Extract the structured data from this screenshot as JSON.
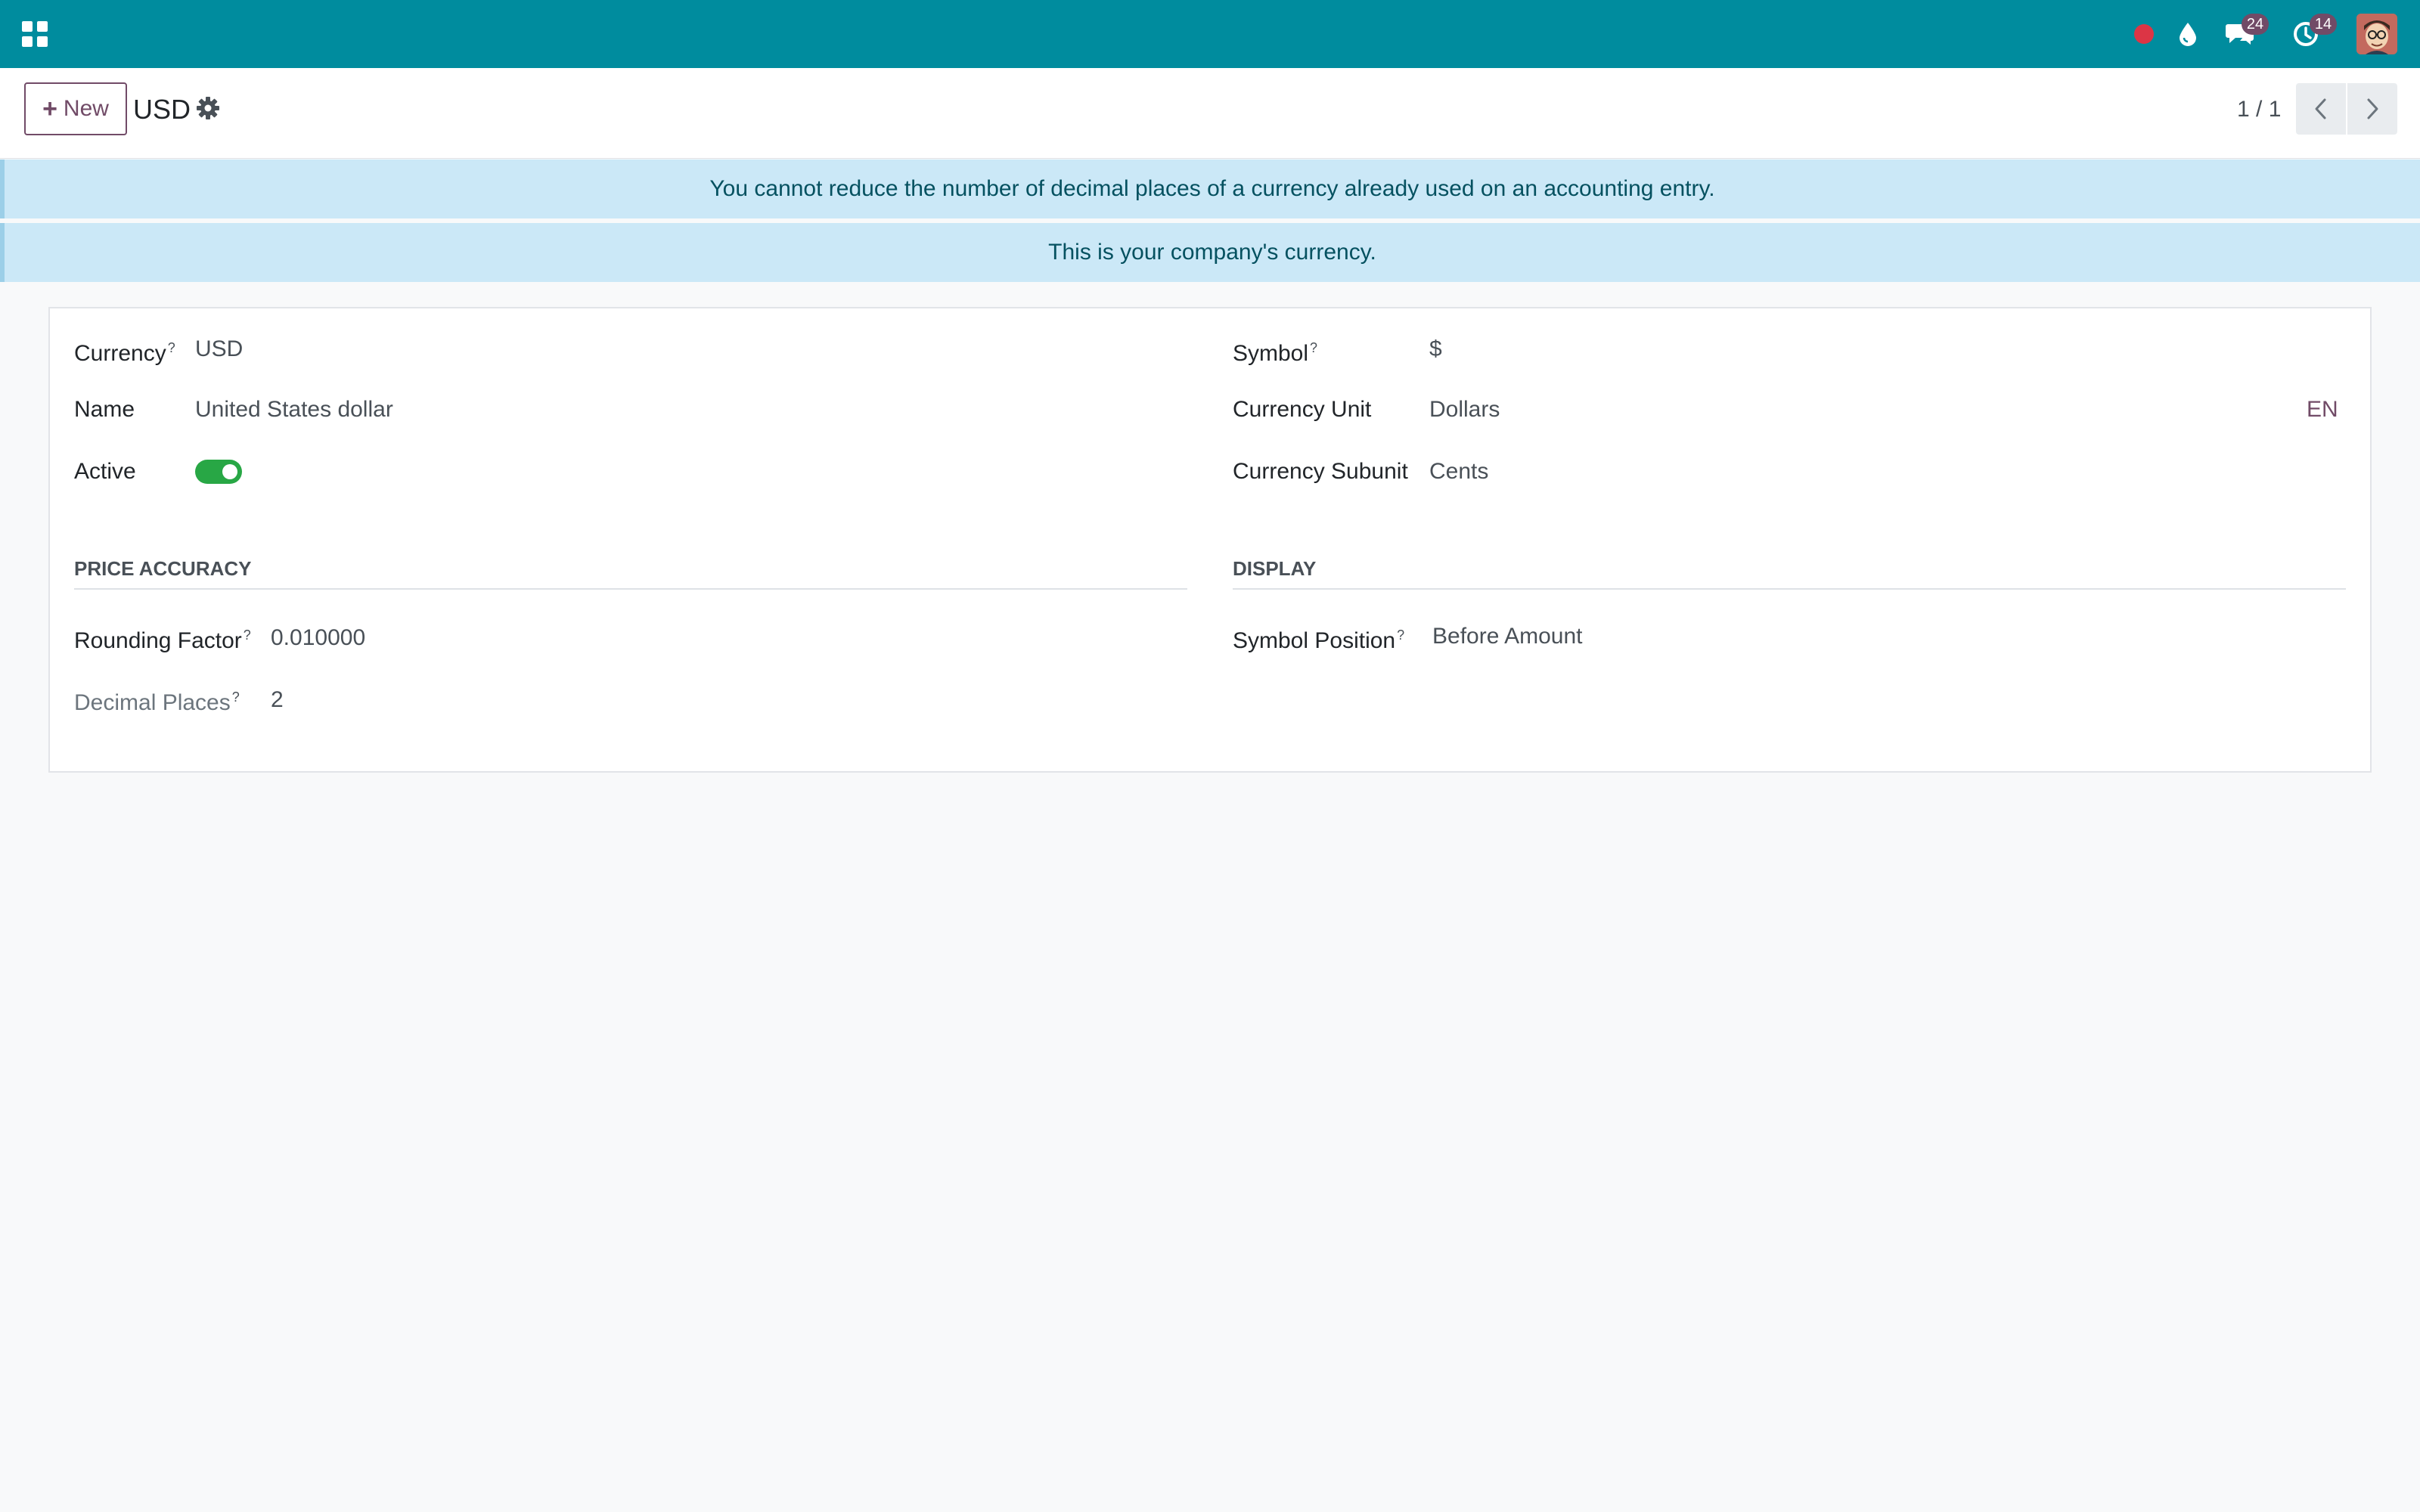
{
  "navbar": {
    "apps_icon": "apps-grid-icon",
    "record_icon": "record-dot-icon",
    "drop_icon": "droplet-icon",
    "chat_icon": "chat-bubbles-icon",
    "chat_count": "24",
    "activity_icon": "clock-icon",
    "activity_count": "14",
    "avatar_icon": "user-avatar-icon",
    "color": "#008c9e"
  },
  "control_panel": {
    "new_label": "New",
    "record_title": "USD",
    "gear_icon": "gear-icon",
    "pager_value": "1 / 1",
    "prev_icon": "chevron-left-icon",
    "next_icon": "chevron-right-icon"
  },
  "alerts": [
    "You cannot reduce the number of decimal places of a currency already used on an accounting entry.",
    "This is your company's currency."
  ],
  "form": {
    "currency": {
      "label": "Currency",
      "help": "?",
      "value": "USD"
    },
    "name": {
      "label": "Name",
      "value": "United States dollar"
    },
    "active": {
      "label": "Active",
      "checked": true
    },
    "symbol": {
      "label": "Symbol",
      "help": "?",
      "value": "$"
    },
    "currency_unit": {
      "label": "Currency Unit",
      "value": "Dollars",
      "lang": "EN"
    },
    "currency_subunit": {
      "label": "Currency Subunit",
      "value": "Cents"
    },
    "price_accuracy": {
      "title": "PRICE ACCURACY",
      "rounding_factor": {
        "label": "Rounding Factor",
        "help": "?",
        "value": "0.010000"
      },
      "decimal_places": {
        "label": "Decimal Places",
        "help": "?",
        "value": "2"
      }
    },
    "display": {
      "title": "DISPLAY",
      "symbol_position": {
        "label": "Symbol Position",
        "help": "?",
        "value": "Before Amount"
      }
    }
  },
  "colors": {
    "accent": "#714b67",
    "alert_bg": "#cbe8f7",
    "alert_text": "#055160",
    "toggle_on": "#28a745"
  }
}
